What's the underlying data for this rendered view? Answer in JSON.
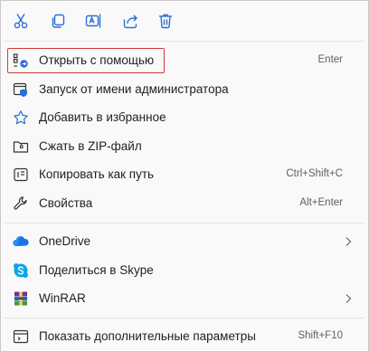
{
  "toolbar": {
    "buttons": [
      {
        "name": "cut-icon"
      },
      {
        "name": "copy-icon"
      },
      {
        "name": "rename-icon"
      },
      {
        "name": "share-icon"
      },
      {
        "name": "delete-icon"
      }
    ]
  },
  "menu": {
    "open_with": {
      "label": "Открыть с помощью",
      "shortcut": "Enter"
    },
    "run_as_admin": {
      "label": "Запуск от имени администратора"
    },
    "add_favorites": {
      "label": "Добавить в избранное"
    },
    "compress_zip": {
      "label": "Сжать в ZIP-файл"
    },
    "copy_path": {
      "label": "Копировать как путь",
      "shortcut": "Ctrl+Shift+C"
    },
    "properties": {
      "label": "Свойства",
      "shortcut": "Alt+Enter"
    },
    "onedrive": {
      "label": "OneDrive"
    },
    "share_skype": {
      "label": "Поделиться в Skype"
    },
    "winrar": {
      "label": "WinRAR"
    },
    "more_options": {
      "label": "Показать дополнительные параметры",
      "shortcut": "Shift+F10"
    }
  },
  "colors": {
    "accent": "#2a6fd6",
    "highlight_border": "#d23a3a",
    "onedrive": "#1a73e8",
    "skype": "#0ea5e9"
  }
}
